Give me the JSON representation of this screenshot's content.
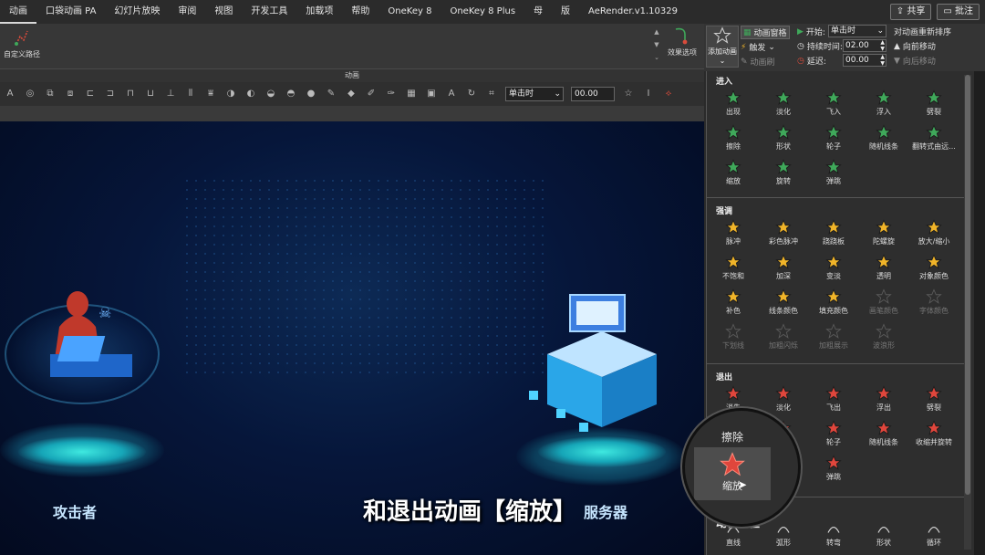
{
  "menubar": {
    "tabs": [
      "动画",
      "口袋动画 PA",
      "幻灯片放映",
      "审阅",
      "视图",
      "开发工具",
      "加载项",
      "帮助",
      "OneKey 8",
      "OneKey 8 Plus",
      "母",
      "版",
      "AeRender.v1.10329"
    ],
    "share_label": "共享",
    "comment_label": "批注"
  },
  "ribbon": {
    "custom_path_label": "自定义路径",
    "effect_options_label": "效果选项",
    "group_label": "动画"
  },
  "anim_pane": {
    "add_animation_label": "添加动画",
    "animation_pane_label": "动画窗格",
    "trigger_label": "触发",
    "anim_brush_label": "动画刷",
    "start_label": "开始:",
    "start_value": "单击时",
    "duration_label": "持续时间:",
    "duration_value": "02.00",
    "delay_label": "延迟:",
    "delay_value": "00.00",
    "reorder_label": "对动画重新排序",
    "move_earlier_label": "向前移动",
    "move_later_label": "向后移动"
  },
  "toolbar2": {
    "start_value": "单击时",
    "duration_value": "00.00"
  },
  "slide": {
    "attacker_label": "攻击者",
    "server_label": "服务器",
    "subtitle": "和退出动画【缩放】"
  },
  "gallery": {
    "entrance_title": "进入",
    "entrance_items": [
      "出现",
      "淡化",
      "飞入",
      "浮入",
      "劈裂",
      "擦除",
      "形状",
      "轮子",
      "随机线条",
      "翻转式由远...",
      "缩放",
      "旋转",
      "弹跳"
    ],
    "emphasis_title": "强调",
    "emphasis_items": [
      "脉冲",
      "彩色脉冲",
      "跷跷板",
      "陀螺旋",
      "放大/缩小",
      "不饱和",
      "加深",
      "变淡",
      "透明",
      "对象颜色",
      "补色",
      "线条颜色",
      "填充颜色",
      "画笔颜色",
      "字体颜色",
      "下划线",
      "加粗闪烁",
      "加粗展示",
      "波浪形"
    ],
    "exit_title": "退出",
    "exit_items": [
      "消失",
      "淡化",
      "飞出",
      "浮出",
      "劈裂",
      "擦除",
      "形状",
      "轮子",
      "随机线条",
      "收缩并旋转",
      "缩放",
      "旋转",
      "弹跳"
    ],
    "motion_title": "动作路径",
    "motion_items": [
      "直线",
      "弧形",
      "转弯",
      "形状",
      "循环"
    ],
    "colors": {
      "entrance": "#3fa85a",
      "emphasis": "#f0b429",
      "exit": "#e0463c",
      "disabled": "#5a5a5a"
    }
  },
  "magnifier": {
    "label_top": "擦除",
    "label_item": "缩放"
  }
}
